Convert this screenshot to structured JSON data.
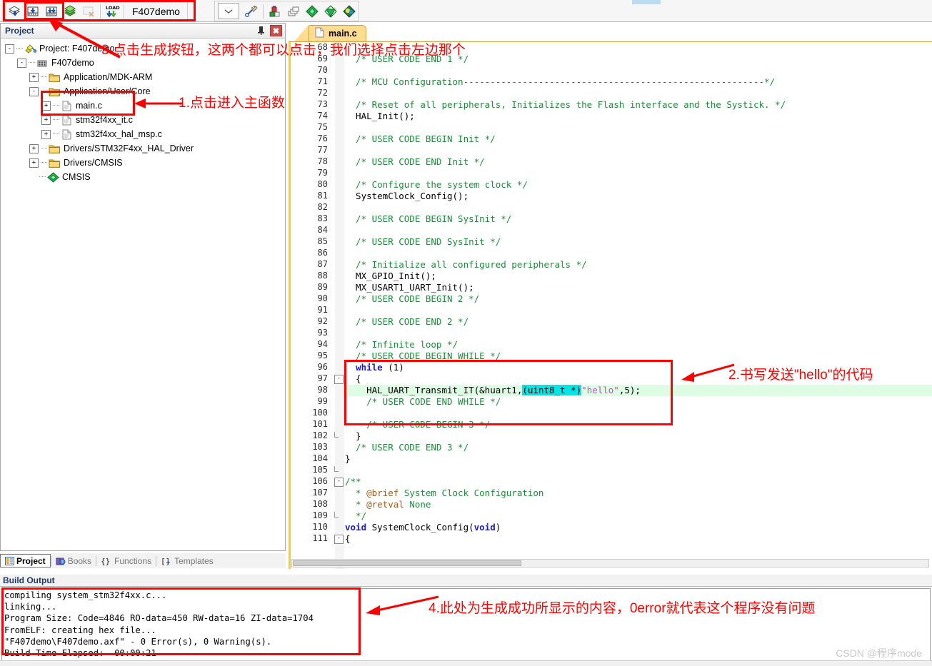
{
  "app": {
    "project_name": "F407demo",
    "watermark": "CSDN @程序mode"
  },
  "toolbar": {
    "buttons": [
      {
        "name": "translate-icon",
        "label": "Translate"
      },
      {
        "name": "build-icon",
        "label": "Build"
      },
      {
        "name": "rebuild-icon",
        "label": "Rebuild"
      },
      {
        "name": "batch-build-icon",
        "label": "Batch Build"
      },
      {
        "name": "stop-build-icon",
        "label": "Stop Build"
      },
      {
        "name": "load-icon",
        "label": "LOAD"
      }
    ],
    "right_buttons": [
      {
        "name": "target-dropdown-icon",
        "label": ""
      },
      {
        "name": "target-options-icon",
        "label": "Options for Target"
      },
      {
        "name": "manage-project-items-icon",
        "label": "Manage Project Items"
      },
      {
        "name": "multi-project-icon",
        "label": "Multi-Project"
      },
      {
        "name": "pack-installer-icon",
        "label": "Pack Installer"
      },
      {
        "name": "manage-run-env-icon",
        "label": "Manage Run-Time Environment"
      },
      {
        "name": "select-software-packs-icon",
        "label": "Select Software Packs"
      }
    ]
  },
  "project_pane": {
    "title": "Project",
    "pin_glyph": "⊓",
    "close_glyph": "✖",
    "tree": [
      {
        "label": "Project: F407demo",
        "depth": 0,
        "expander": "-",
        "icon": "project-icon"
      },
      {
        "label": "F407demo",
        "depth": 1,
        "expander": "-",
        "icon": "target-icon"
      },
      {
        "label": "Application/MDK-ARM",
        "depth": 2,
        "expander": "+",
        "icon": "folder-icon"
      },
      {
        "label": "Application/User/Core",
        "depth": 2,
        "expander": "-",
        "icon": "folder-open-icon"
      },
      {
        "label": "main.c",
        "depth": 3,
        "expander": "+",
        "icon": "file-icon"
      },
      {
        "label": "stm32f4xx_it.c",
        "depth": 3,
        "expander": "+",
        "icon": "file-icon"
      },
      {
        "label": "stm32f4xx_hal_msp.c",
        "depth": 3,
        "expander": "+",
        "icon": "file-icon"
      },
      {
        "label": "Drivers/STM32F4xx_HAL_Driver",
        "depth": 2,
        "expander": "+",
        "icon": "folder-icon"
      },
      {
        "label": "Drivers/CMSIS",
        "depth": 2,
        "expander": "+",
        "icon": "folder-icon"
      },
      {
        "label": "CMSIS",
        "depth": 2,
        "expander": "",
        "icon": "cmsis-icon"
      }
    ]
  },
  "bottom_tabs": [
    {
      "label": "Project",
      "icon": "project-tab-icon",
      "active": true
    },
    {
      "label": "Books",
      "icon": "books-tab-icon",
      "active": false
    },
    {
      "label": "Functions",
      "icon": "functions-tab-icon",
      "active": false
    },
    {
      "label": "Templates",
      "icon": "templates-tab-icon",
      "active": false
    }
  ],
  "editor": {
    "tab_label": "main.c",
    "first_line_number": 68,
    "lines": [
      {
        "n": 68,
        "text": ""
      },
      {
        "n": 69,
        "text": "  /* USER CODE END 1 */",
        "type": "comment"
      },
      {
        "n": 70,
        "text": ""
      },
      {
        "n": 71,
        "text": "  /* MCU Configuration--------------------------------------------------------*/",
        "type": "comment"
      },
      {
        "n": 72,
        "text": ""
      },
      {
        "n": 73,
        "text": "  /* Reset of all peripherals, Initializes the Flash interface and the Systick. */",
        "type": "comment"
      },
      {
        "n": 74,
        "text": "  HAL_Init();",
        "type": "code"
      },
      {
        "n": 75,
        "text": ""
      },
      {
        "n": 76,
        "text": "  /* USER CODE BEGIN Init */",
        "type": "comment"
      },
      {
        "n": 77,
        "text": ""
      },
      {
        "n": 78,
        "text": "  /* USER CODE END Init */",
        "type": "comment"
      },
      {
        "n": 79,
        "text": ""
      },
      {
        "n": 80,
        "text": "  /* Configure the system clock */",
        "type": "comment"
      },
      {
        "n": 81,
        "text": "  SystemClock_Config();",
        "type": "code"
      },
      {
        "n": 82,
        "text": ""
      },
      {
        "n": 83,
        "text": "  /* USER CODE BEGIN SysInit */",
        "type": "comment"
      },
      {
        "n": 84,
        "text": ""
      },
      {
        "n": 85,
        "text": "  /* USER CODE END SysInit */",
        "type": "comment"
      },
      {
        "n": 86,
        "text": ""
      },
      {
        "n": 87,
        "text": "  /* Initialize all configured peripherals */",
        "type": "comment"
      },
      {
        "n": 88,
        "text": "  MX_GPIO_Init();",
        "type": "code"
      },
      {
        "n": 89,
        "text": "  MX_USART1_UART_Init();",
        "type": "code"
      },
      {
        "n": 90,
        "text": "  /* USER CODE BEGIN 2 */",
        "type": "comment"
      },
      {
        "n": 91,
        "text": ""
      },
      {
        "n": 92,
        "text": "  /* USER CODE END 2 */",
        "type": "comment"
      },
      {
        "n": 93,
        "text": ""
      },
      {
        "n": 94,
        "text": "  /* Infinite loop */",
        "type": "comment"
      },
      {
        "n": 95,
        "text": "  /* USER CODE BEGIN WHILE */",
        "type": "comment"
      },
      {
        "n": 96,
        "text": "  while (1)",
        "type": "keyword-line"
      },
      {
        "n": 97,
        "text": "  {",
        "type": "code",
        "fold": "-"
      },
      {
        "n": 98,
        "text": "    HAL_UART_Transmit_IT(&huart1,(uint8_t *)\"hello\",5);",
        "type": "highlighted"
      },
      {
        "n": 99,
        "text": "    /* USER CODE END WHILE */",
        "type": "comment"
      },
      {
        "n": 100,
        "text": ""
      },
      {
        "n": 101,
        "text": "    /* USER CODE BEGIN 3 */",
        "type": "comment"
      },
      {
        "n": 102,
        "text": "  }",
        "type": "code",
        "fold": "end"
      },
      {
        "n": 103,
        "text": "  /* USER CODE END 3 */",
        "type": "comment"
      },
      {
        "n": 104,
        "text": "}",
        "type": "code"
      },
      {
        "n": 105,
        "text": "",
        "fold": "end"
      },
      {
        "n": 106,
        "text": "/**",
        "type": "comment",
        "fold": "-"
      },
      {
        "n": 107,
        "text": "  * @brief System Clock Configuration",
        "type": "comment-brief"
      },
      {
        "n": 108,
        "text": "  * @retval None",
        "type": "comment-brief"
      },
      {
        "n": 109,
        "text": "  */",
        "type": "comment",
        "fold": "end"
      },
      {
        "n": 110,
        "text": "void SystemClock_Config(void)",
        "type": "decl"
      },
      {
        "n": 111,
        "text": "{",
        "type": "code",
        "fold": "-"
      }
    ],
    "line98_parts": {
      "call": "HAL_UART_Transmit_IT",
      "args_prefix": "(&huart1,",
      "cast_selected": "(uint8_t *)",
      "string": "\"hello\"",
      "tail": ",5);"
    }
  },
  "build_output": {
    "title": "Build Output",
    "lines": [
      "compiling system_stm32f4xx.c...",
      "linking...",
      "Program Size: Code=4846 RO-data=450 RW-data=16 ZI-data=1704",
      "FromELF: creating hex file...",
      "\"F407demo\\F407demo.axf\" - 0 Error(s), 0 Warning(s).",
      "Build Time Elapsed:  00:00:21"
    ]
  },
  "annotations": {
    "accent_color": "#fe0000",
    "note1": "1.点击进入主函数",
    "note2": "2.书写发送\"hello\"的代码",
    "note3": "3.点击生成按钮，这两个都可以点击，我们选择点击左边那个",
    "note4": "4.此处为生成成功所显示的内容，0error就代表这个程序没有问题"
  }
}
